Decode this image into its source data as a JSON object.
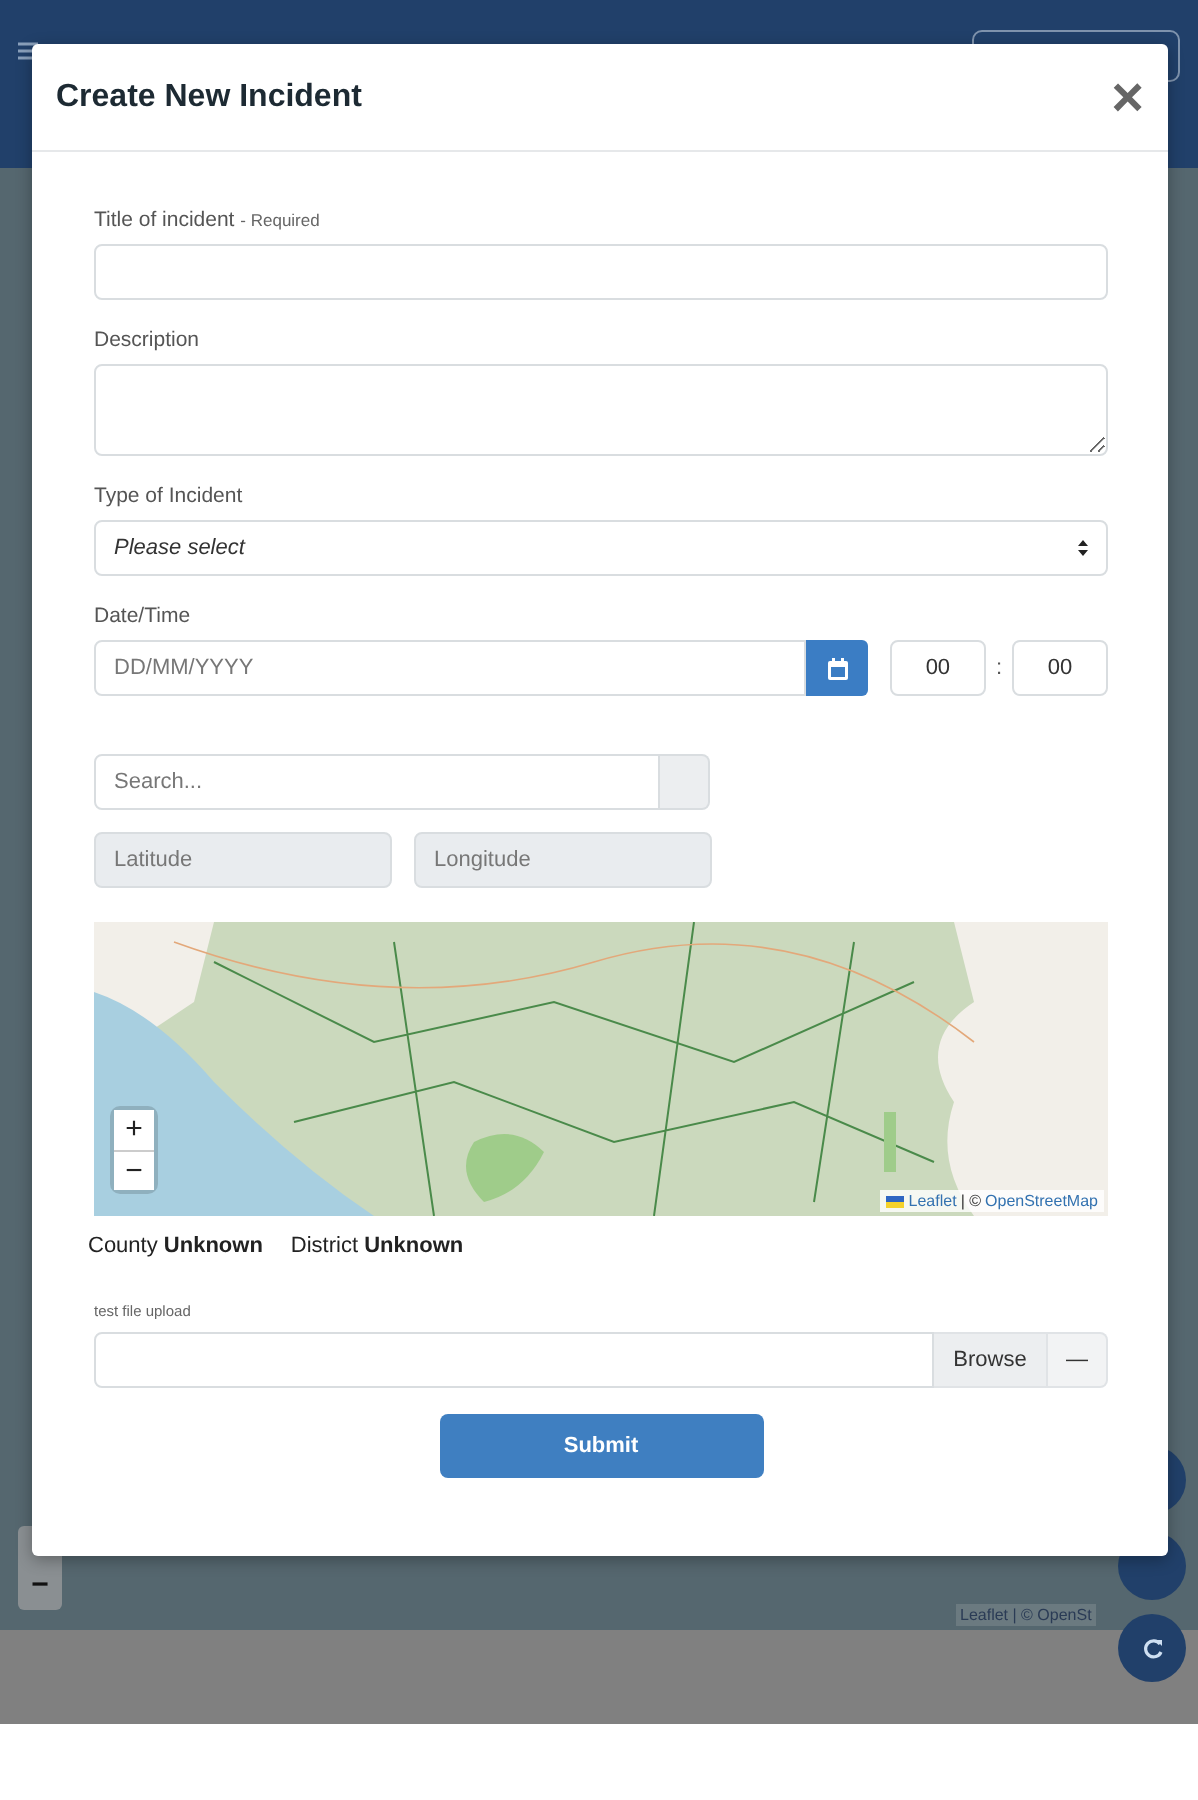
{
  "modal": {
    "title": "Create New Incident",
    "close": "×"
  },
  "title_field": {
    "label": "Title of incident",
    "hint": "- Required"
  },
  "description": {
    "label": "Description"
  },
  "incident_type": {
    "label": "Type of Incident",
    "placeholder": "Please select"
  },
  "datetime": {
    "label": "Date/Time",
    "placeholder": "DD/MM/YYYY",
    "hour": "00",
    "separator": ":",
    "minute": "00"
  },
  "location": {
    "search_placeholder": "Search...",
    "latitude_placeholder": "Latitude",
    "longitude_placeholder": "Longitude"
  },
  "map": {
    "kind": "picture",
    "zoom_in": "+",
    "zoom_out": "−",
    "attribution_link": "Leaflet",
    "attribution_separator": "| ©",
    "attribution_source": "OpenStreetMap"
  },
  "region": [
    {
      "label": "County",
      "value": "Unknown"
    },
    {
      "label": "District",
      "value": "Unknown"
    }
  ],
  "upload": {
    "label": "test file upload",
    "browse": "Browse",
    "remove": "—"
  },
  "submit": "Submit",
  "background": {
    "zoom_out": "−",
    "attribution": "Leaflet | © OpenSt"
  }
}
